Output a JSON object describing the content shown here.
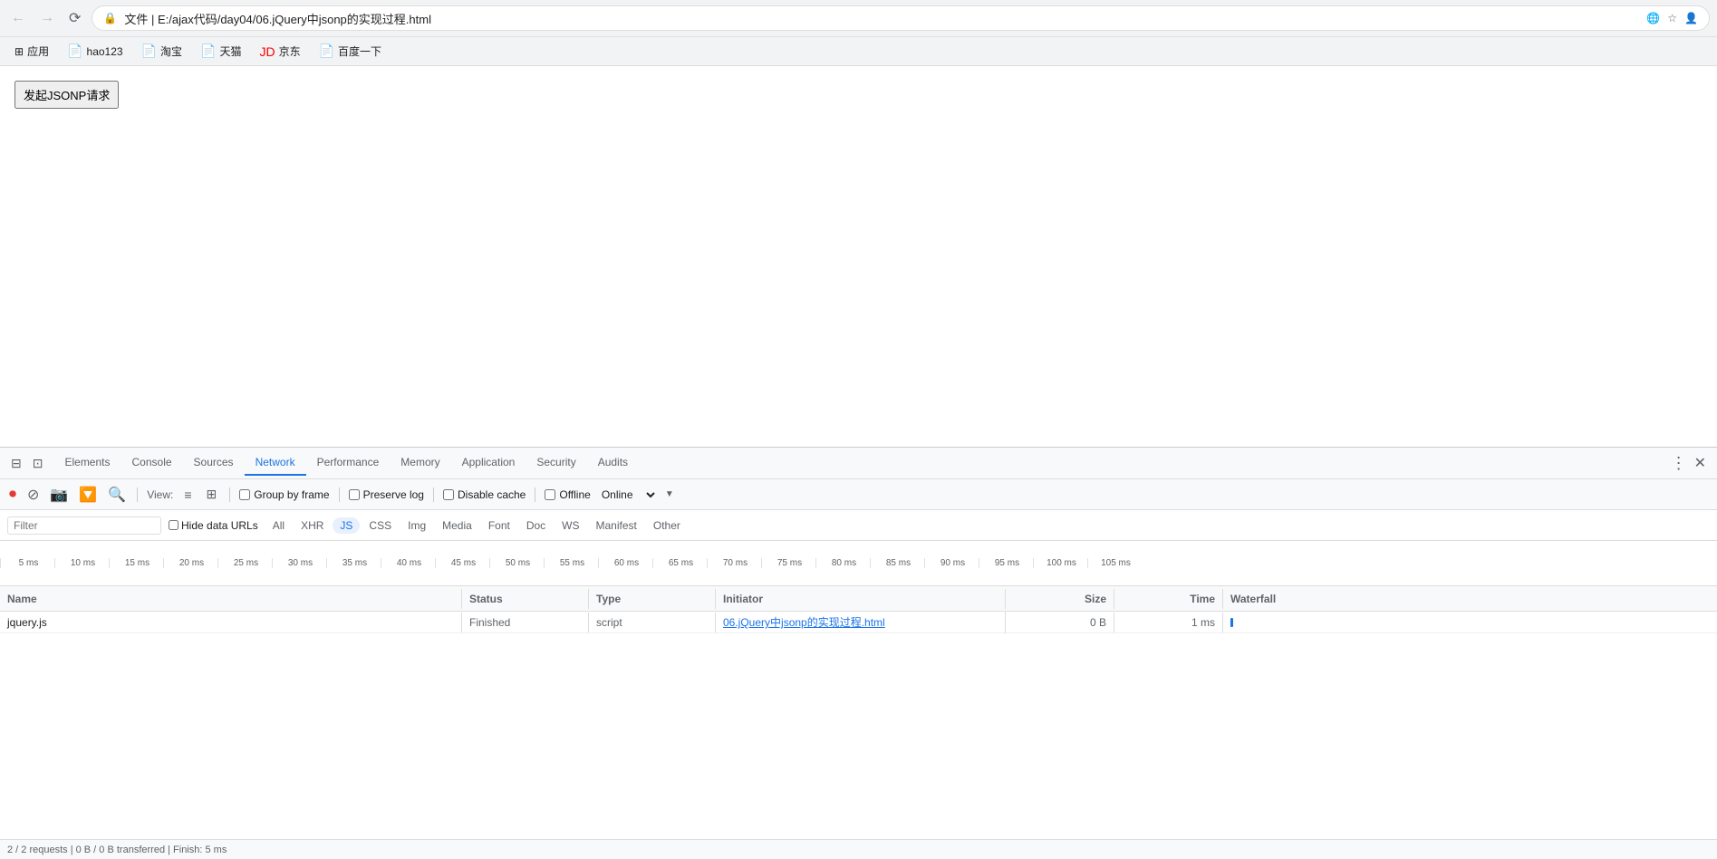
{
  "browser": {
    "back_disabled": true,
    "forward_disabled": true,
    "address": "文件  |  E:/ajax代码/day04/06.jQuery中jsonp的实现过程.html",
    "lock_icon": "🔒",
    "translate_icon": "🌐",
    "star_icon": "☆",
    "user_icon": "👤"
  },
  "bookmarks": [
    {
      "id": "apps",
      "label": "应用",
      "icon": "⊞"
    },
    {
      "id": "hao123",
      "label": "hao123",
      "icon": "📄"
    },
    {
      "id": "taobao",
      "label": "淘宝",
      "icon": "📄"
    },
    {
      "id": "tmall",
      "label": "天猫",
      "icon": "📄"
    },
    {
      "id": "jd",
      "label": "京东",
      "icon": "🔴"
    },
    {
      "id": "baidu",
      "label": "百度一下",
      "icon": "📄"
    }
  ],
  "page": {
    "button_label": "发起JSONP请求"
  },
  "devtools": {
    "tabs": [
      {
        "id": "elements",
        "label": "Elements"
      },
      {
        "id": "console",
        "label": "Console"
      },
      {
        "id": "sources",
        "label": "Sources"
      },
      {
        "id": "network",
        "label": "Network"
      },
      {
        "id": "performance",
        "label": "Performance"
      },
      {
        "id": "memory",
        "label": "Memory"
      },
      {
        "id": "application",
        "label": "Application"
      },
      {
        "id": "security",
        "label": "Security"
      },
      {
        "id": "audits",
        "label": "Audits"
      }
    ],
    "active_tab": "network"
  },
  "network_toolbar": {
    "view_label": "View:",
    "group_by_frame_label": "Group by frame",
    "preserve_log_label": "Preserve log",
    "disable_cache_label": "Disable cache",
    "offline_label": "Offline",
    "online_label": "Online"
  },
  "filter_bar": {
    "placeholder": "Filter",
    "hide_data_urls_label": "Hide data URLs",
    "types": [
      {
        "id": "all",
        "label": "All"
      },
      {
        "id": "xhr",
        "label": "XHR"
      },
      {
        "id": "js",
        "label": "JS",
        "active": true
      },
      {
        "id": "css",
        "label": "CSS"
      },
      {
        "id": "img",
        "label": "Img"
      },
      {
        "id": "media",
        "label": "Media"
      },
      {
        "id": "font",
        "label": "Font"
      },
      {
        "id": "doc",
        "label": "Doc"
      },
      {
        "id": "ws",
        "label": "WS"
      },
      {
        "id": "manifest",
        "label": "Manifest"
      },
      {
        "id": "other",
        "label": "Other"
      }
    ]
  },
  "timeline": {
    "labels": [
      "5 ms",
      "10 ms",
      "15 ms",
      "20 ms",
      "25 ms",
      "30 ms",
      "35 ms",
      "40 ms",
      "45 ms",
      "50 ms",
      "55 ms",
      "60 ms",
      "65 ms",
      "70 ms",
      "75 ms",
      "80 ms",
      "85 ms",
      "90 ms",
      "95 ms",
      "100 ms",
      "105 ms"
    ]
  },
  "table": {
    "headers": {
      "name": "Name",
      "status": "Status",
      "type": "Type",
      "initiator": "Initiator",
      "size": "Size",
      "time": "Time",
      "waterfall": "Waterfall"
    },
    "rows": [
      {
        "name": "jquery.js",
        "status": "Finished",
        "type": "script",
        "initiator": "06.jQuery中jsonp的实现过程.html",
        "size": "0 B",
        "time": "1 ms"
      }
    ]
  },
  "status_bar": {
    "text": "2 / 2 requests  |  0 B / 0 B transferred  |  Finish: 5 ms"
  }
}
